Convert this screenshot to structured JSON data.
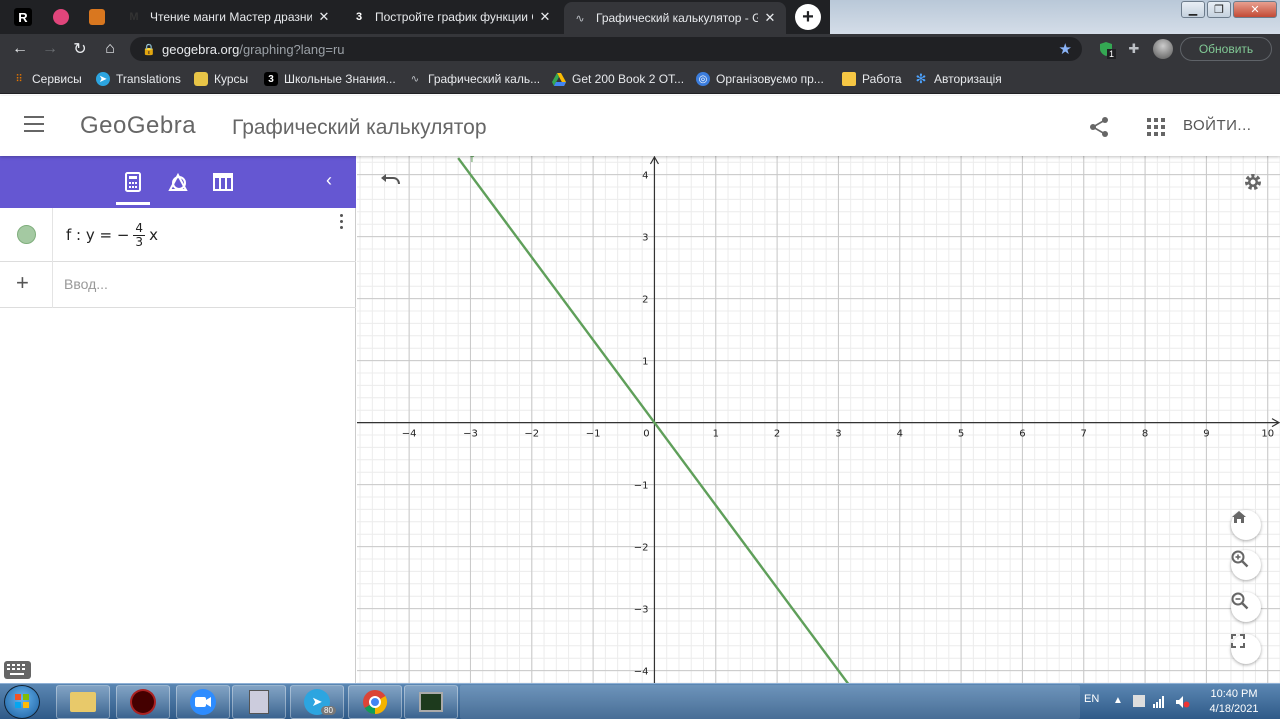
{
  "browser": {
    "tabs": [
      {
        "title": "Чтение манги Мастер дразнил",
        "favicon_text": "M",
        "favicon_bg": "#f5e6c8"
      },
      {
        "title": "Постройте график функции Срс",
        "favicon_text": "3",
        "favicon_bg": "#111111"
      },
      {
        "title": "Графический калькулятор - Geo",
        "favicon_text": "∿",
        "favicon_bg": "#35363a"
      }
    ],
    "pinned_letter": "R",
    "address": {
      "host": "geogebra.org",
      "path": "/graphing?lang=ru"
    },
    "update_label": "Обновить",
    "ext_badge": "1",
    "bookmarks": [
      {
        "label": "Сервисы",
        "icon": "apps-grid-icon"
      },
      {
        "label": "Translations",
        "icon": "telegram-icon"
      },
      {
        "label": "Курсы",
        "icon": "image-icon"
      },
      {
        "label": "Школьные Знания...",
        "icon": "znanija-icon"
      },
      {
        "label": "Графический каль...",
        "icon": "geogebra-icon"
      },
      {
        "label": "Get 200 Book 2 OT...",
        "icon": "drive-icon"
      },
      {
        "label": "Організовуємо пр...",
        "icon": "globe-icon"
      },
      {
        "label": "Работа",
        "icon": "folder-icon"
      },
      {
        "label": "Авторизація",
        "icon": "gear-icon"
      }
    ]
  },
  "geogebra": {
    "logo": "GeoGebra",
    "title": "Графический калькулятор",
    "signin": "ВОЙТИ...",
    "algebra": {
      "formula_prefix": "f : y = −",
      "numerator": "4",
      "denominator": "3",
      "formula_suffix": "x",
      "input_placeholder": "Ввод..."
    },
    "accent_color": "#6557d2",
    "line_color": "#5f9f5a"
  },
  "chart_data": {
    "type": "line",
    "function_label": "f",
    "series": [
      {
        "name": "f",
        "x": [
          -3.2,
          3.2
        ],
        "y": [
          4.2667,
          -4.2667
        ]
      }
    ],
    "xlim": [
      -4.85,
      10.2
    ],
    "ylim": [
      -4.2,
      4.3
    ],
    "x_ticks": [
      -4,
      -3,
      -2,
      -1,
      0,
      1,
      2,
      3,
      4,
      5,
      6,
      7,
      8,
      9,
      10
    ],
    "y_ticks": [
      -4,
      -3,
      -2,
      -1,
      1,
      2,
      3,
      4
    ],
    "grid": true,
    "minor_grid": true
  },
  "taskbar": {
    "lang": "EN",
    "time": "10:40 PM",
    "date": "4/18/2021",
    "telegram_badge": "80"
  }
}
